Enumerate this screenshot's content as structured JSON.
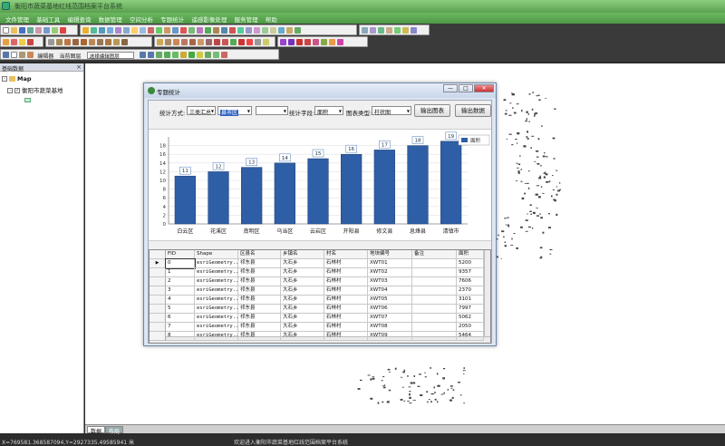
{
  "app": {
    "title": "衡阳市蔬菜基地红线范围档案平台系统",
    "menu": [
      "文件管理",
      "基础工具",
      "编辑查询",
      "数据管理",
      "空间分析",
      "专题统计",
      "遥感影像处理",
      "服务管理",
      "帮助"
    ]
  },
  "toolbar": {
    "editor_label": "编辑器",
    "current_layer_label": "当前图层",
    "select_layer_combo": "选择编辑图层"
  },
  "left_panel": {
    "header": "基础数据",
    "close": "×",
    "root": "Map",
    "layer": "衡阳市蔬菜基地",
    "expand": "-",
    "check": "✓"
  },
  "bottom_tabs": [
    "数据",
    "布局"
  ],
  "status": {
    "coordinates": "X=769581.368587094,Y=2927335.49585941 米",
    "welcome": "欢迎进入衡阳市蔬菜基地红线范围档案平台系统"
  },
  "dialog": {
    "title": "专题统计",
    "win_min": "—",
    "win_max": "□",
    "win_close": "✕",
    "controls": {
      "method_label": "统计方式:",
      "method_value": "三类汇总",
      "field1_value": "县市区",
      "field2_value": "",
      "stat_field_label": "统计字段:",
      "stat_field_value": "面积",
      "chart_type_label": "图表类型:",
      "chart_type_value": "柱状图",
      "export_chart_btn": "输出图表",
      "export_data_btn": "输出数据"
    },
    "grid": {
      "columns": [
        "FID",
        "Shape",
        "区县名",
        "乡镇名",
        "村名",
        "地块编号",
        "备注",
        "面积"
      ],
      "rows": [
        [
          "0",
          "esriGeometry...",
          "祁东县",
          "大石乡",
          "石林村",
          "XWT01",
          "",
          "5200"
        ],
        [
          "1",
          "esriGeometry...",
          "祁东县",
          "大石乡",
          "石林村",
          "XWT02",
          "",
          "9357"
        ],
        [
          "2",
          "esriGeometry...",
          "祁东县",
          "大石乡",
          "石林村",
          "XWT03",
          "",
          "7606"
        ],
        [
          "3",
          "esriGeometry...",
          "祁东县",
          "大石乡",
          "石林村",
          "XWT04",
          "",
          "2370"
        ],
        [
          "4",
          "esriGeometry...",
          "祁东县",
          "大石乡",
          "石林村",
          "XWT05",
          "",
          "3101"
        ],
        [
          "5",
          "esriGeometry...",
          "祁东县",
          "大石乡",
          "石林村",
          "XWT06",
          "",
          "7997"
        ],
        [
          "6",
          "esriGeometry...",
          "祁东县",
          "大石乡",
          "石林村",
          "XWT07",
          "",
          "5062"
        ],
        [
          "7",
          "esriGeometry...",
          "祁东县",
          "大石乡",
          "石林村",
          "XWT08",
          "",
          "2050"
        ],
        [
          "8",
          "esriGeometry...",
          "祁东县",
          "大石乡",
          "石林村",
          "XWT09",
          "",
          "5464"
        ]
      ],
      "current_row_marker": "▶"
    }
  },
  "chart_data": {
    "type": "bar",
    "categories": [
      "白云区",
      "花溪区",
      "南明区",
      "乌当区",
      "云岩区",
      "开阳县",
      "修文县",
      "息烽县",
      "清镇市"
    ],
    "values": [
      11,
      12,
      13,
      14,
      15,
      16,
      17,
      18,
      19
    ],
    "series": [
      {
        "name": "面积",
        "values": [
          11,
          12,
          13,
          14,
          15,
          16,
          17,
          18,
          19
        ]
      }
    ],
    "yticks": [
      0,
      2,
      4,
      6,
      8,
      10,
      12,
      14,
      16,
      18
    ],
    "ylim": [
      0,
      20
    ],
    "grid": true,
    "legend": "top-right",
    "color": "#2e5ea5"
  }
}
